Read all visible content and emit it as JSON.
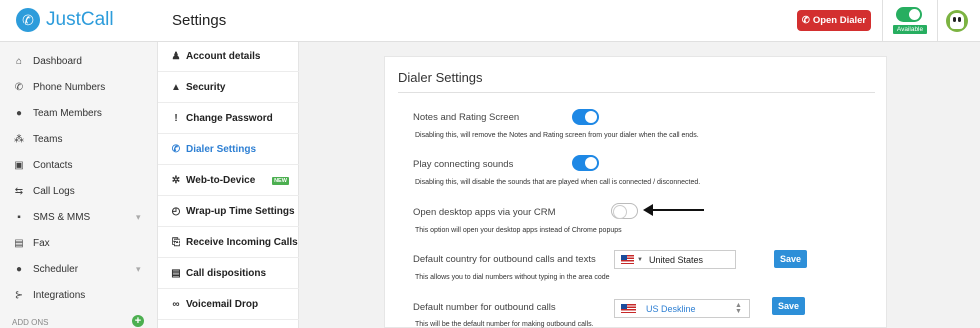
{
  "header": {
    "logo_text": "JustCall",
    "page_title": "Settings",
    "open_dialer_label": "Open Dialer",
    "availability_badge": "Available"
  },
  "sidebar": {
    "items": [
      {
        "label": "Dashboard",
        "icon": "home-icon"
      },
      {
        "label": "Phone Numbers",
        "icon": "phone-icon"
      },
      {
        "label": "Team Members",
        "icon": "users-icon"
      },
      {
        "label": "Teams",
        "icon": "teams-icon"
      },
      {
        "label": "Contacts",
        "icon": "contacts-icon"
      },
      {
        "label": "Call Logs",
        "icon": "call-logs-icon"
      },
      {
        "label": "SMS & MMS",
        "icon": "sms-icon"
      },
      {
        "label": "Fax",
        "icon": "fax-icon"
      },
      {
        "label": "Scheduler",
        "icon": "scheduler-icon"
      },
      {
        "label": "Integrations",
        "icon": "integrations-icon"
      }
    ],
    "addons_label": "ADD ONS"
  },
  "settings_menu": {
    "items": [
      {
        "label": "Account details",
        "icon": "person-icon"
      },
      {
        "label": "Security",
        "icon": "lock-icon"
      },
      {
        "label": "Change Password",
        "icon": "thermometer-icon"
      },
      {
        "label": "Dialer Settings",
        "icon": "phone-icon"
      },
      {
        "label": "Web-to-Device",
        "icon": "gear-icon"
      },
      {
        "label": "Wrap-up Time Settings",
        "icon": "timer-icon"
      },
      {
        "label": "Receive Incoming Calls",
        "icon": "incoming-icon"
      },
      {
        "label": "Call dispositions",
        "icon": "list-icon"
      },
      {
        "label": "Voicemail Drop",
        "icon": "voicemail-icon"
      }
    ],
    "active_item": "Dialer Settings",
    "new_badge": "NEW"
  },
  "dialer_settings": {
    "title": "Dialer Settings",
    "notes_rating": {
      "label": "Notes and Rating Screen",
      "help": "Disabling this, will remove the Notes and Rating screen from your dialer when the call ends.",
      "enabled": true
    },
    "connecting_sounds": {
      "label": "Play connecting sounds",
      "help": "Disabling this, will disable the sounds that are played when call is connected / disconnected.",
      "enabled": true
    },
    "desktop_apps": {
      "label": "Open desktop apps via your CRM",
      "help": "This option will open your desktop apps instead of Chrome popups",
      "enabled": false
    },
    "default_country": {
      "label": "Default country for outbound calls and texts",
      "help": "This allows you to dial numbers without typing in the area code",
      "value": "United States",
      "save_label": "Save"
    },
    "default_number": {
      "label": "Default number for outbound calls",
      "help": "This will be the default number for making outbound calls.",
      "value": "US Deskline",
      "save_label": "Save"
    }
  },
  "colors": {
    "brand": "#2d9cdb",
    "toggle_on": "#1e88e5",
    "open_dialer": "#d32f2f",
    "available": "#27ae60",
    "save_button": "#2d8fd8"
  }
}
